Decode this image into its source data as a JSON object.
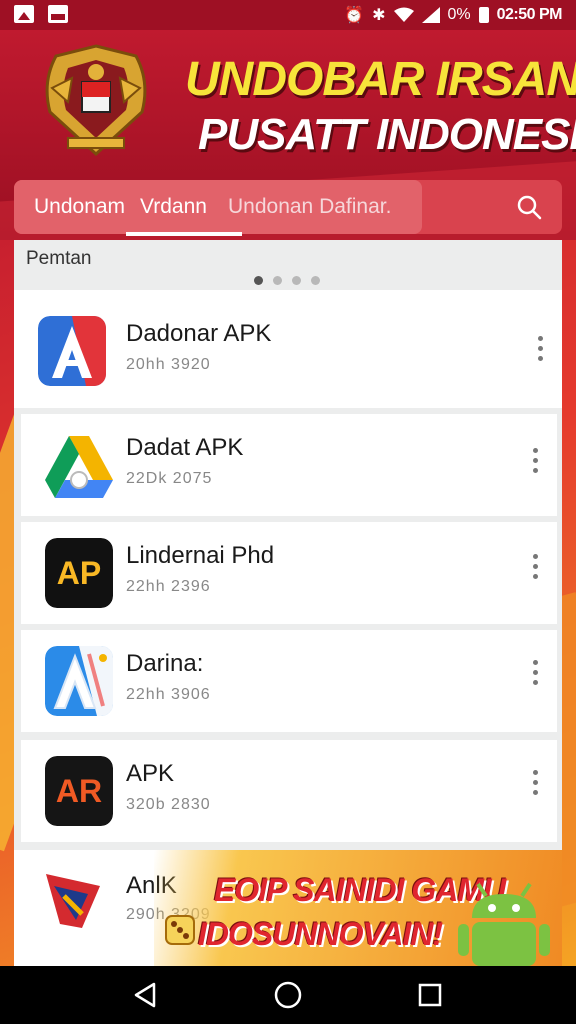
{
  "status_bar": {
    "battery": "0%",
    "time": "02:50 PM"
  },
  "header": {
    "title_line1": "UNDOBAR IRSAN",
    "title_line2": "PUSATT INDONESIA",
    "emblem_icon": "garuda-emblem-icon"
  },
  "tabs": [
    {
      "label": "Undonam"
    },
    {
      "label": "Vrdann"
    },
    {
      "label": "Undonan Dafinar."
    }
  ],
  "section": {
    "label": "Pemtan",
    "carousel_pages": 4,
    "carousel_active": 1
  },
  "apps": [
    {
      "name": "Dadonar APK",
      "meta": "20hh 3920",
      "icon": "letter-a-red-blue-icon"
    },
    {
      "name": "Dadat APK",
      "meta": "22Dk 2075",
      "icon": "drive-triangle-icon"
    },
    {
      "name": "Lindernai Phd",
      "meta": "22hh 2396",
      "icon": "ap-logo-icon"
    },
    {
      "name": "Darina:",
      "meta": "22hh 3906",
      "icon": "letter-a-blue-icon"
    },
    {
      "name": "APK",
      "meta": "320b 2830",
      "icon": "ar-logo-icon"
    },
    {
      "name": "AnlK",
      "meta": "290h 3209",
      "icon": "flag-arrow-icon"
    }
  ],
  "promo": {
    "line1": "EOIP SAINIDI GAMU",
    "line2": "IDOSUNNOVAIN!"
  },
  "colors": {
    "brand_red": "#b3152a",
    "title_yellow": "#f7e43a",
    "accent_orange": "#f08a24"
  }
}
